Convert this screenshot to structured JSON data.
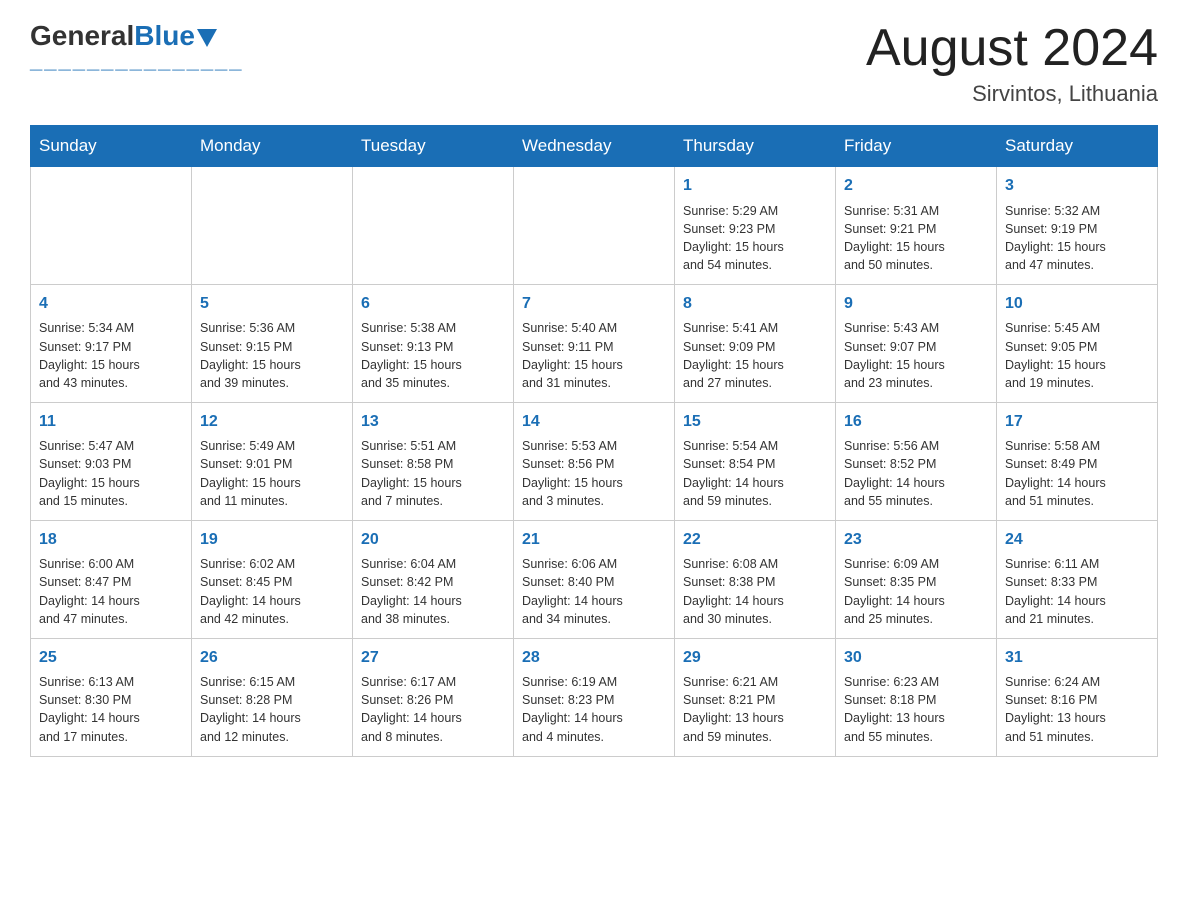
{
  "header": {
    "logo_general": "General",
    "logo_blue": "Blue",
    "title": "August 2024",
    "subtitle": "Sirvintos, Lithuania"
  },
  "days_of_week": [
    "Sunday",
    "Monday",
    "Tuesday",
    "Wednesday",
    "Thursday",
    "Friday",
    "Saturday"
  ],
  "weeks": [
    [
      {
        "num": "",
        "info": ""
      },
      {
        "num": "",
        "info": ""
      },
      {
        "num": "",
        "info": ""
      },
      {
        "num": "",
        "info": ""
      },
      {
        "num": "1",
        "info": "Sunrise: 5:29 AM\nSunset: 9:23 PM\nDaylight: 15 hours\nand 54 minutes."
      },
      {
        "num": "2",
        "info": "Sunrise: 5:31 AM\nSunset: 9:21 PM\nDaylight: 15 hours\nand 50 minutes."
      },
      {
        "num": "3",
        "info": "Sunrise: 5:32 AM\nSunset: 9:19 PM\nDaylight: 15 hours\nand 47 minutes."
      }
    ],
    [
      {
        "num": "4",
        "info": "Sunrise: 5:34 AM\nSunset: 9:17 PM\nDaylight: 15 hours\nand 43 minutes."
      },
      {
        "num": "5",
        "info": "Sunrise: 5:36 AM\nSunset: 9:15 PM\nDaylight: 15 hours\nand 39 minutes."
      },
      {
        "num": "6",
        "info": "Sunrise: 5:38 AM\nSunset: 9:13 PM\nDaylight: 15 hours\nand 35 minutes."
      },
      {
        "num": "7",
        "info": "Sunrise: 5:40 AM\nSunset: 9:11 PM\nDaylight: 15 hours\nand 31 minutes."
      },
      {
        "num": "8",
        "info": "Sunrise: 5:41 AM\nSunset: 9:09 PM\nDaylight: 15 hours\nand 27 minutes."
      },
      {
        "num": "9",
        "info": "Sunrise: 5:43 AM\nSunset: 9:07 PM\nDaylight: 15 hours\nand 23 minutes."
      },
      {
        "num": "10",
        "info": "Sunrise: 5:45 AM\nSunset: 9:05 PM\nDaylight: 15 hours\nand 19 minutes."
      }
    ],
    [
      {
        "num": "11",
        "info": "Sunrise: 5:47 AM\nSunset: 9:03 PM\nDaylight: 15 hours\nand 15 minutes."
      },
      {
        "num": "12",
        "info": "Sunrise: 5:49 AM\nSunset: 9:01 PM\nDaylight: 15 hours\nand 11 minutes."
      },
      {
        "num": "13",
        "info": "Sunrise: 5:51 AM\nSunset: 8:58 PM\nDaylight: 15 hours\nand 7 minutes."
      },
      {
        "num": "14",
        "info": "Sunrise: 5:53 AM\nSunset: 8:56 PM\nDaylight: 15 hours\nand 3 minutes."
      },
      {
        "num": "15",
        "info": "Sunrise: 5:54 AM\nSunset: 8:54 PM\nDaylight: 14 hours\nand 59 minutes."
      },
      {
        "num": "16",
        "info": "Sunrise: 5:56 AM\nSunset: 8:52 PM\nDaylight: 14 hours\nand 55 minutes."
      },
      {
        "num": "17",
        "info": "Sunrise: 5:58 AM\nSunset: 8:49 PM\nDaylight: 14 hours\nand 51 minutes."
      }
    ],
    [
      {
        "num": "18",
        "info": "Sunrise: 6:00 AM\nSunset: 8:47 PM\nDaylight: 14 hours\nand 47 minutes."
      },
      {
        "num": "19",
        "info": "Sunrise: 6:02 AM\nSunset: 8:45 PM\nDaylight: 14 hours\nand 42 minutes."
      },
      {
        "num": "20",
        "info": "Sunrise: 6:04 AM\nSunset: 8:42 PM\nDaylight: 14 hours\nand 38 minutes."
      },
      {
        "num": "21",
        "info": "Sunrise: 6:06 AM\nSunset: 8:40 PM\nDaylight: 14 hours\nand 34 minutes."
      },
      {
        "num": "22",
        "info": "Sunrise: 6:08 AM\nSunset: 8:38 PM\nDaylight: 14 hours\nand 30 minutes."
      },
      {
        "num": "23",
        "info": "Sunrise: 6:09 AM\nSunset: 8:35 PM\nDaylight: 14 hours\nand 25 minutes."
      },
      {
        "num": "24",
        "info": "Sunrise: 6:11 AM\nSunset: 8:33 PM\nDaylight: 14 hours\nand 21 minutes."
      }
    ],
    [
      {
        "num": "25",
        "info": "Sunrise: 6:13 AM\nSunset: 8:30 PM\nDaylight: 14 hours\nand 17 minutes."
      },
      {
        "num": "26",
        "info": "Sunrise: 6:15 AM\nSunset: 8:28 PM\nDaylight: 14 hours\nand 12 minutes."
      },
      {
        "num": "27",
        "info": "Sunrise: 6:17 AM\nSunset: 8:26 PM\nDaylight: 14 hours\nand 8 minutes."
      },
      {
        "num": "28",
        "info": "Sunrise: 6:19 AM\nSunset: 8:23 PM\nDaylight: 14 hours\nand 4 minutes."
      },
      {
        "num": "29",
        "info": "Sunrise: 6:21 AM\nSunset: 8:21 PM\nDaylight: 13 hours\nand 59 minutes."
      },
      {
        "num": "30",
        "info": "Sunrise: 6:23 AM\nSunset: 8:18 PM\nDaylight: 13 hours\nand 55 minutes."
      },
      {
        "num": "31",
        "info": "Sunrise: 6:24 AM\nSunset: 8:16 PM\nDaylight: 13 hours\nand 51 minutes."
      }
    ]
  ]
}
